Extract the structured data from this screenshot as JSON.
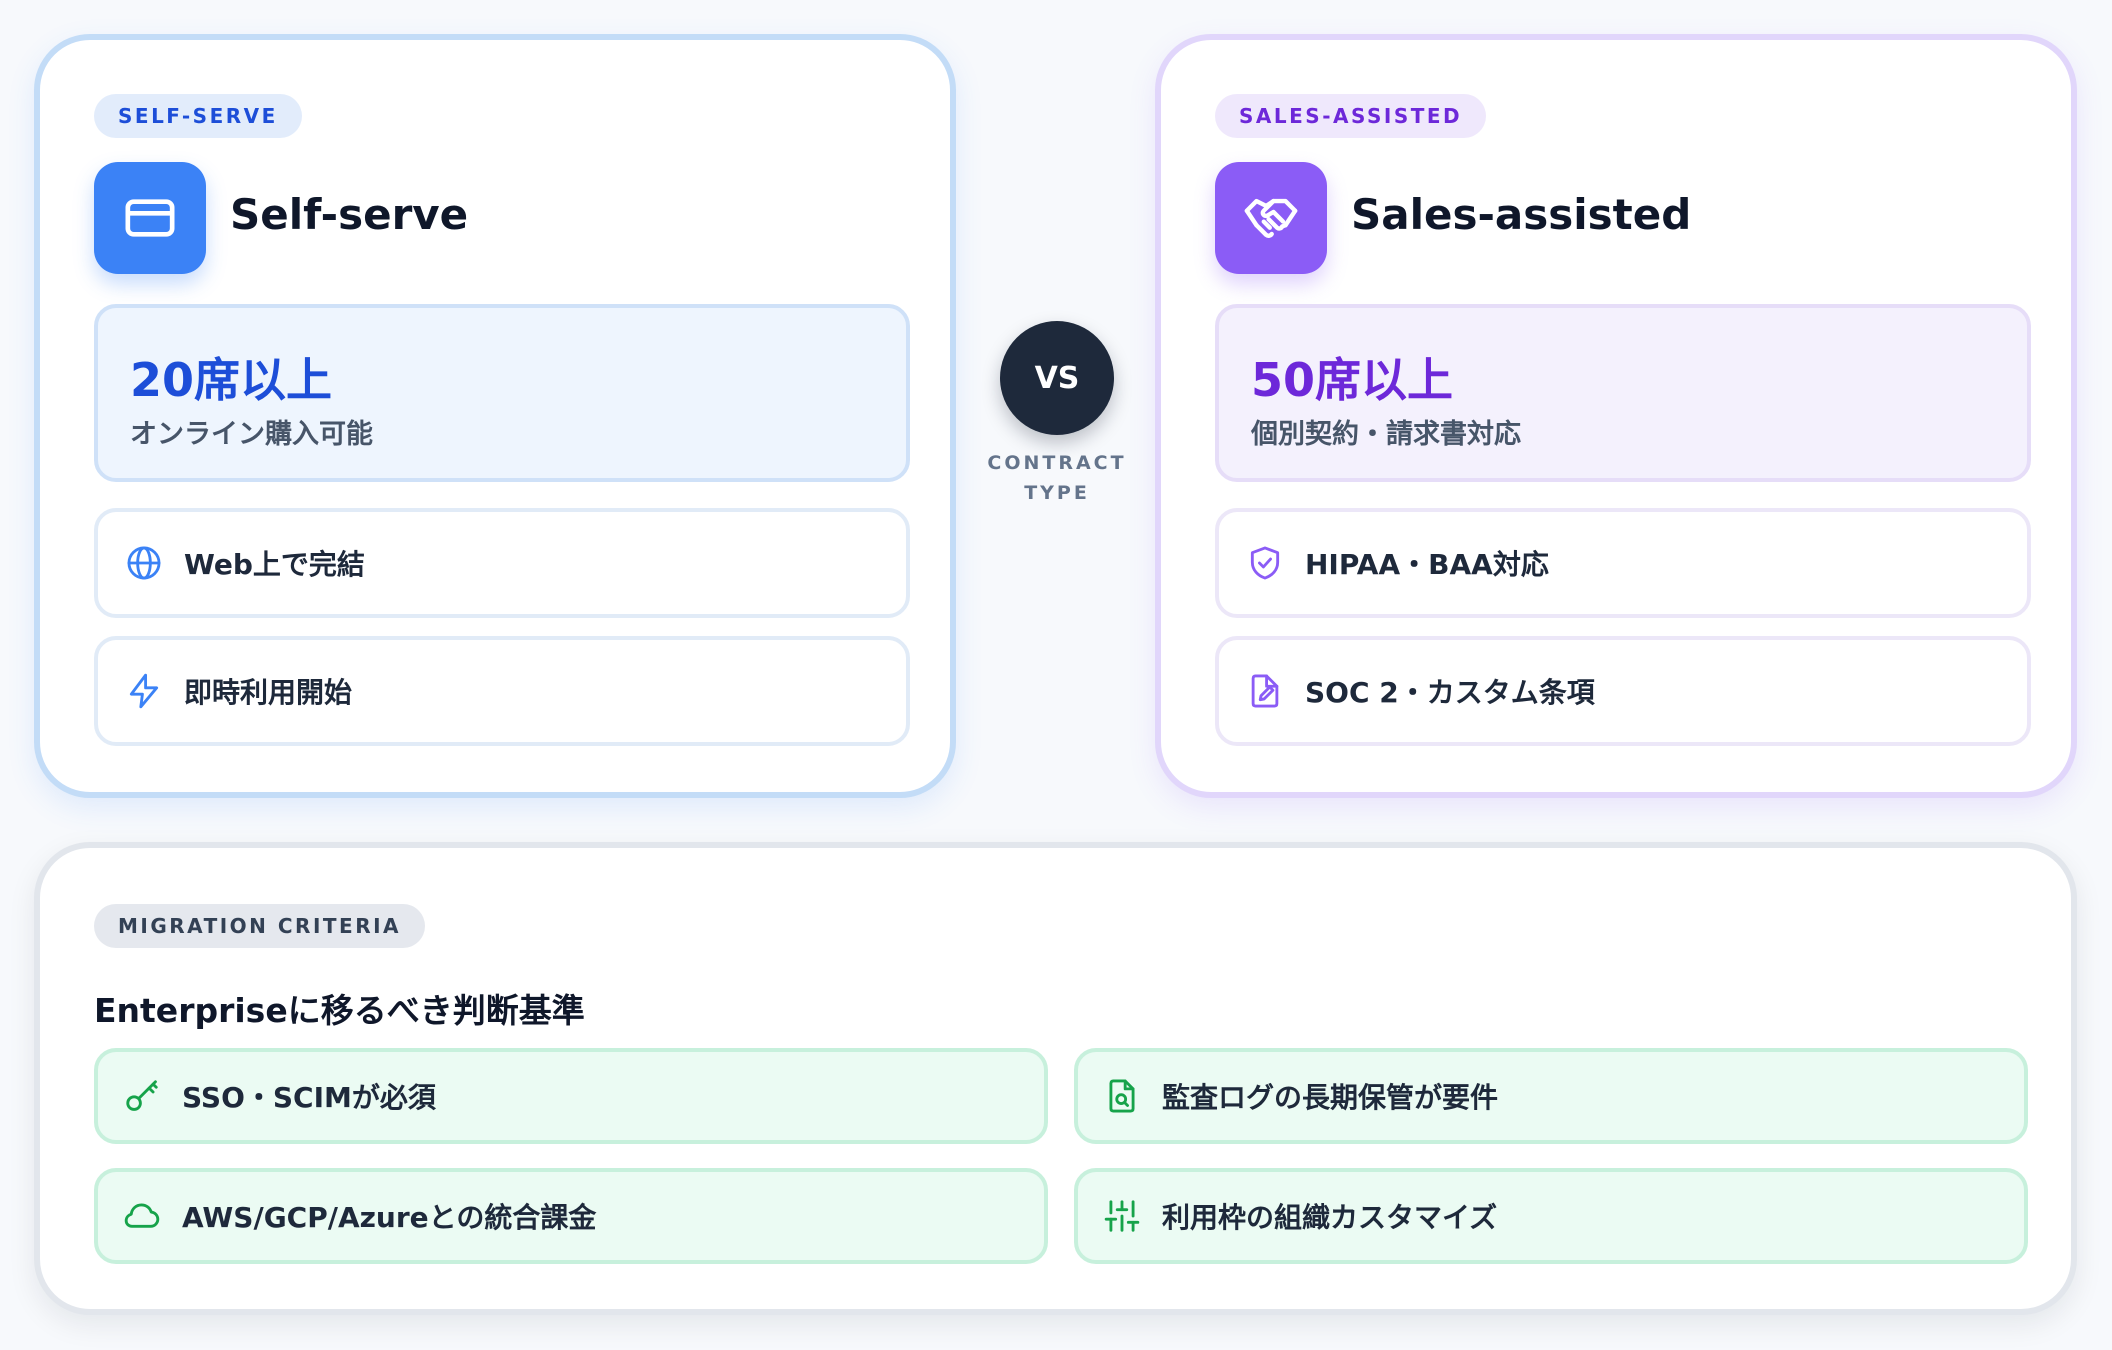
{
  "self_serve": {
    "badge": "SELF-SERVE",
    "title": "Self-serve",
    "icon": "credit-card-icon",
    "metric_value": "20席以上",
    "metric_sub": "オンライン購入可能",
    "features": [
      {
        "icon": "globe-icon",
        "label": "Web上で完結"
      },
      {
        "icon": "lightning-icon",
        "label": "即時利用開始"
      }
    ],
    "accent": "#3b82f6",
    "metric_color": "#1d4ed8"
  },
  "vs": {
    "label": "VS",
    "caption_line1": "CONTRACT",
    "caption_line2": "TYPE"
  },
  "sales_assisted": {
    "badge": "SALES-ASSISTED",
    "title": "Sales-assisted",
    "icon": "handshake-icon",
    "metric_value": "50席以上",
    "metric_sub": "個別契約・請求書対応",
    "features": [
      {
        "icon": "shield-check-icon",
        "label": "HIPAA・BAA対応"
      },
      {
        "icon": "document-edit-icon",
        "label": "SOC 2・カスタム条項"
      }
    ],
    "accent": "#8b5cf6",
    "metric_color": "#6d28d9"
  },
  "migration": {
    "badge": "MIGRATION CRITERIA",
    "title": "Enterpriseに移るべき判断基準",
    "criteria": [
      {
        "icon": "key-icon",
        "label": "SSO・SCIMが必須"
      },
      {
        "icon": "file-search-icon",
        "label": "監査ログの長期保管が要件"
      },
      {
        "icon": "cloud-icon",
        "label": "AWS/GCP/Azureとの統合課金"
      },
      {
        "icon": "sliders-icon",
        "label": "利用枠の組織カスタマイズ"
      }
    ],
    "accent": "#16a34a"
  }
}
